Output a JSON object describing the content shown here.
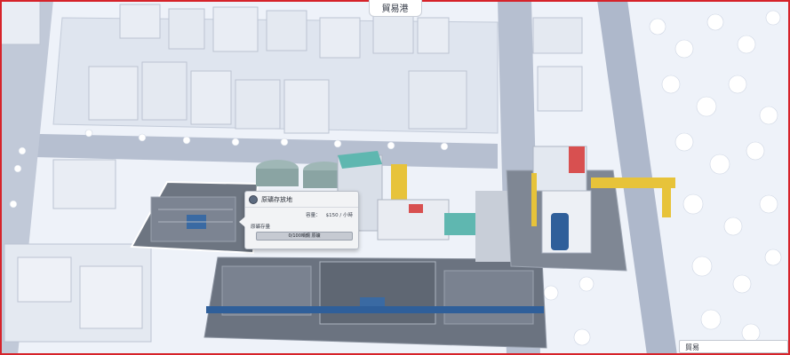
{
  "title": "貿易港",
  "popup": {
    "name": "原礦存放地",
    "production_label": "容量：",
    "production_value": "$150 / 小時",
    "storage_label": "原礦存量",
    "storage_value": "0/100噸鋼 原礦",
    "storage_fill": 0
  },
  "bottom_button": "貿易",
  "colors": {
    "frame": "#d6232a",
    "snow": "#f4f7fc",
    "road": "#aab4c8",
    "building": "#e6ebf3",
    "lot": "#6f7784",
    "accent_teal": "#5fb7b0",
    "accent_yellow": "#e7c33a"
  }
}
